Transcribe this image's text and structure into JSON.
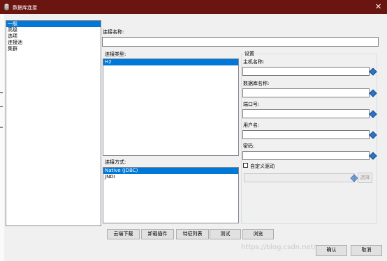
{
  "window": {
    "title": "数据库连接",
    "close_glyph": "✕"
  },
  "nav": {
    "items": [
      {
        "label": "一般",
        "selected": true
      },
      {
        "label": "高级",
        "selected": false
      },
      {
        "label": "选项",
        "selected": false
      },
      {
        "label": "连接池",
        "selected": false
      },
      {
        "label": "集群",
        "selected": false
      }
    ]
  },
  "connection_name": {
    "label": "连接名称:",
    "value": ""
  },
  "connection_type": {
    "label": "连接类型:",
    "items": [
      "H2"
    ],
    "selected": "H2"
  },
  "access_method": {
    "label": "连接方式:",
    "items": [
      "Native (JDBC)",
      "JNDI"
    ],
    "selected": "Native (JDBC)"
  },
  "settings": {
    "group_label": "设置",
    "host": {
      "label": "主机名称:",
      "value": ""
    },
    "database": {
      "label": "数据库名称:",
      "value": ""
    },
    "port": {
      "label": "端口号:",
      "value": ""
    },
    "user": {
      "label": "用户名:",
      "value": ""
    },
    "password": {
      "label": "密码:",
      "value": ""
    },
    "custom_driver": {
      "label": "自定义驱动",
      "checked": false
    },
    "driver_path": {
      "value": ""
    },
    "choose_button": "选择"
  },
  "bottom_buttons": {
    "cloud_download": "云端下载",
    "uninstall_plugin": "卸载插件",
    "feature_list": "特征列表",
    "test": "测试",
    "browse": "浏览"
  },
  "dialog_buttons": {
    "ok": "确认",
    "cancel": "取消"
  },
  "watermark": "https://blog.csdn.net/qq_...",
  "colors": {
    "titlebar": "#6b1510",
    "selection": "#0078d7",
    "icon_blue": "#2d74c7"
  }
}
